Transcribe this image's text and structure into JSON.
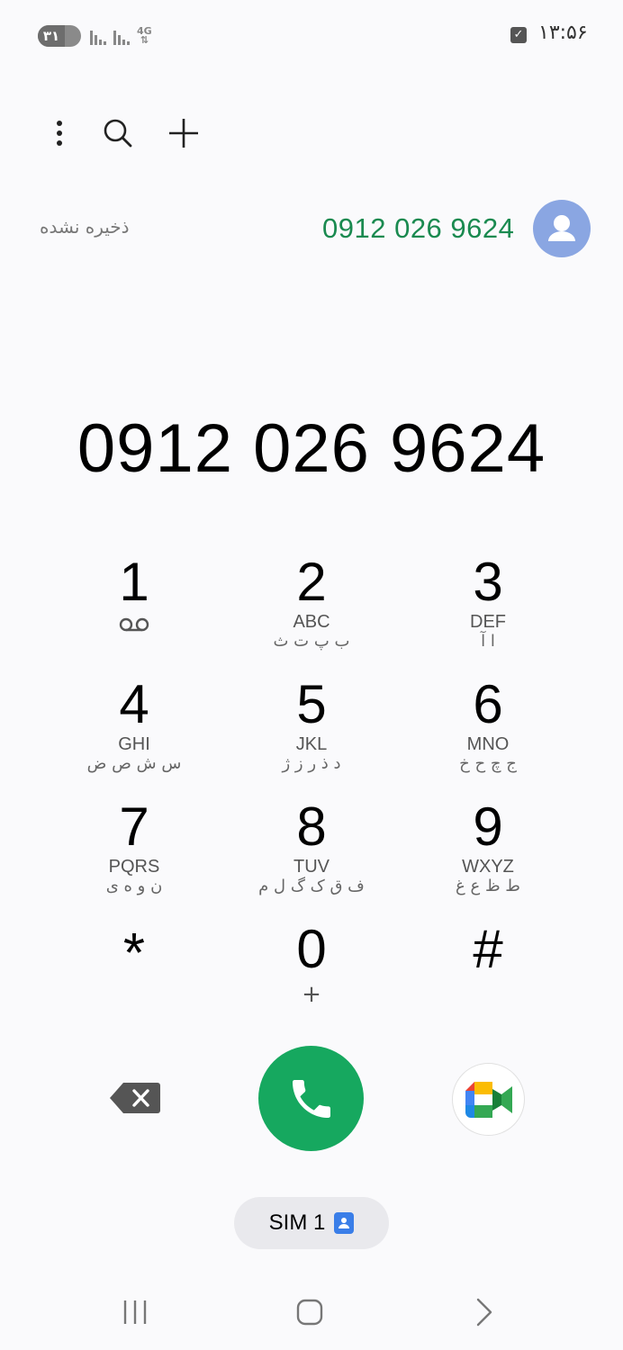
{
  "status_bar": {
    "time": "۱۳:۵۶",
    "battery_level": "۳۱",
    "network_type": "4G"
  },
  "toolbar": {
    "more_icon": "more-vertical-icon",
    "search_icon": "search-icon",
    "add_icon": "plus-icon"
  },
  "suggestion": {
    "status_label": "ذخیره نشده",
    "number": "0912 026 9624",
    "avatar_icon": "person-icon"
  },
  "dialed_number": "0912 026 9624",
  "keypad": {
    "keys": [
      {
        "digit": "1",
        "latin": "",
        "persian": "",
        "extra": "voicemail-icon"
      },
      {
        "digit": "2",
        "latin": "ABC",
        "persian": "ب پ ت ث"
      },
      {
        "digit": "3",
        "latin": "DEF",
        "persian": "ا آ"
      },
      {
        "digit": "4",
        "latin": "GHI",
        "persian": "س ش ص ض"
      },
      {
        "digit": "5",
        "latin": "JKL",
        "persian": "د ذ ر ز ژ"
      },
      {
        "digit": "6",
        "latin": "MNO",
        "persian": "ج چ ح خ"
      },
      {
        "digit": "7",
        "latin": "PQRS",
        "persian": "ن و ه ی"
      },
      {
        "digit": "8",
        "latin": "TUV",
        "persian": "ف ق ک گ ل م"
      },
      {
        "digit": "9",
        "latin": "WXYZ",
        "persian": "ط ظ ع غ"
      },
      {
        "digit": "*",
        "latin": "",
        "persian": ""
      },
      {
        "digit": "0",
        "latin": "",
        "persian": "",
        "extra": "+"
      },
      {
        "digit": "#",
        "latin": "",
        "persian": ""
      }
    ]
  },
  "actions": {
    "backspace_icon": "backspace-icon",
    "call_icon": "phone-icon",
    "video_icon": "google-meet-icon",
    "sim_label": "SIM 1",
    "sim_icon": "contact-card-icon"
  },
  "nav_bar": {
    "recents_icon": "recents-icon",
    "home_icon": "home-icon",
    "back_icon": "back-icon"
  },
  "colors": {
    "call_green": "#16a85f",
    "number_green": "#1a8a50",
    "avatar_blue": "#8aa6e2",
    "sim_blue": "#3a7ee8"
  }
}
